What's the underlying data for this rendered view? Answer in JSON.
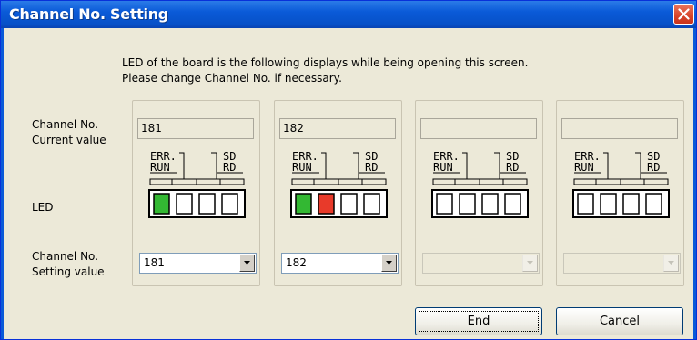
{
  "window": {
    "title": "Channel No. Setting",
    "close_icon": "close-icon"
  },
  "message": {
    "line1": "LED of the board is the following displays while being opening this screen.",
    "line2": "Please change Channel No. if necessary."
  },
  "labels": {
    "current_line1": "Channel No.",
    "current_line2": "Current value",
    "led": "LED",
    "setting_line1": "Channel No.",
    "setting_line2": "Setting value"
  },
  "led_labels": {
    "err": "ERR.",
    "run": "RUN",
    "sd": "SD",
    "rd": "RD"
  },
  "channels": [
    {
      "current": "181",
      "setting": "181",
      "enabled": true,
      "leds": [
        "green",
        "off",
        "off",
        "off"
      ]
    },
    {
      "current": "182",
      "setting": "182",
      "enabled": true,
      "leds": [
        "green",
        "red",
        "off",
        "off"
      ]
    },
    {
      "current": "",
      "setting": "",
      "enabled": false,
      "leds": [
        "off",
        "off",
        "off",
        "off"
      ]
    },
    {
      "current": "",
      "setting": "",
      "enabled": false,
      "leds": [
        "off",
        "off",
        "off",
        "off"
      ]
    }
  ],
  "colors": {
    "led_green": "#33b833",
    "led_red": "#e83a2a",
    "titlebar": "#0a5ad8"
  },
  "buttons": {
    "end": "End",
    "cancel": "Cancel"
  }
}
